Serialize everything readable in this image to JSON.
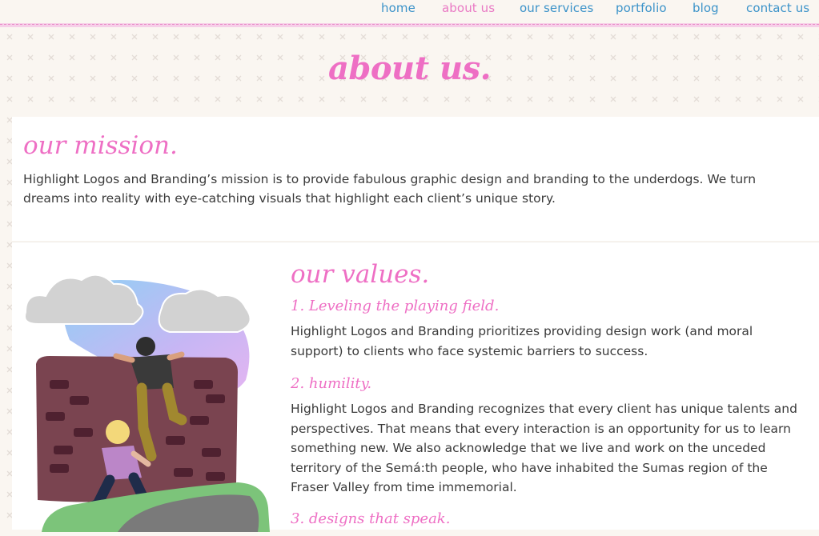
{
  "nav": {
    "items": [
      {
        "label": "home",
        "active": false
      },
      {
        "label": "about us",
        "active": true
      },
      {
        "label": "our services",
        "active": false
      },
      {
        "label": "portfolio",
        "active": false
      },
      {
        "label": "blog",
        "active": false
      },
      {
        "label": "contact us",
        "active": false
      }
    ]
  },
  "page": {
    "title": "about us."
  },
  "mission": {
    "heading": "our mission.",
    "text": "Highlight Logos and Branding’s mission is to provide fabulous graphic design and branding to the underdogs. We turn dreams into reality with eye-catching visuals that highlight each client’s unique story."
  },
  "values": {
    "heading": "our values.",
    "items": [
      {
        "title": "1. Leveling the playing field.",
        "text": "Highlight Logos and Branding prioritizes providing design work (and moral support) to clients who face systemic barriers to success."
      },
      {
        "title": "2. humility.",
        "text": "Highlight Logos and Branding recognizes that every client has unique talents and perspectives. That means that every interaction is an opportunity for us to learn something new. We also acknowledge that we live and work on the unceded territory of the Semá:th people, who have inhabited the Sumas region of the Fraser Valley from time immemorial."
      },
      {
        "title": "3. designs that speak.",
        "text": ""
      }
    ]
  },
  "colors": {
    "accent_pink": "#ee6fc4",
    "nav_blue": "#3c93c9",
    "background": "#faf6f1",
    "body_text": "#3a3a3a"
  }
}
